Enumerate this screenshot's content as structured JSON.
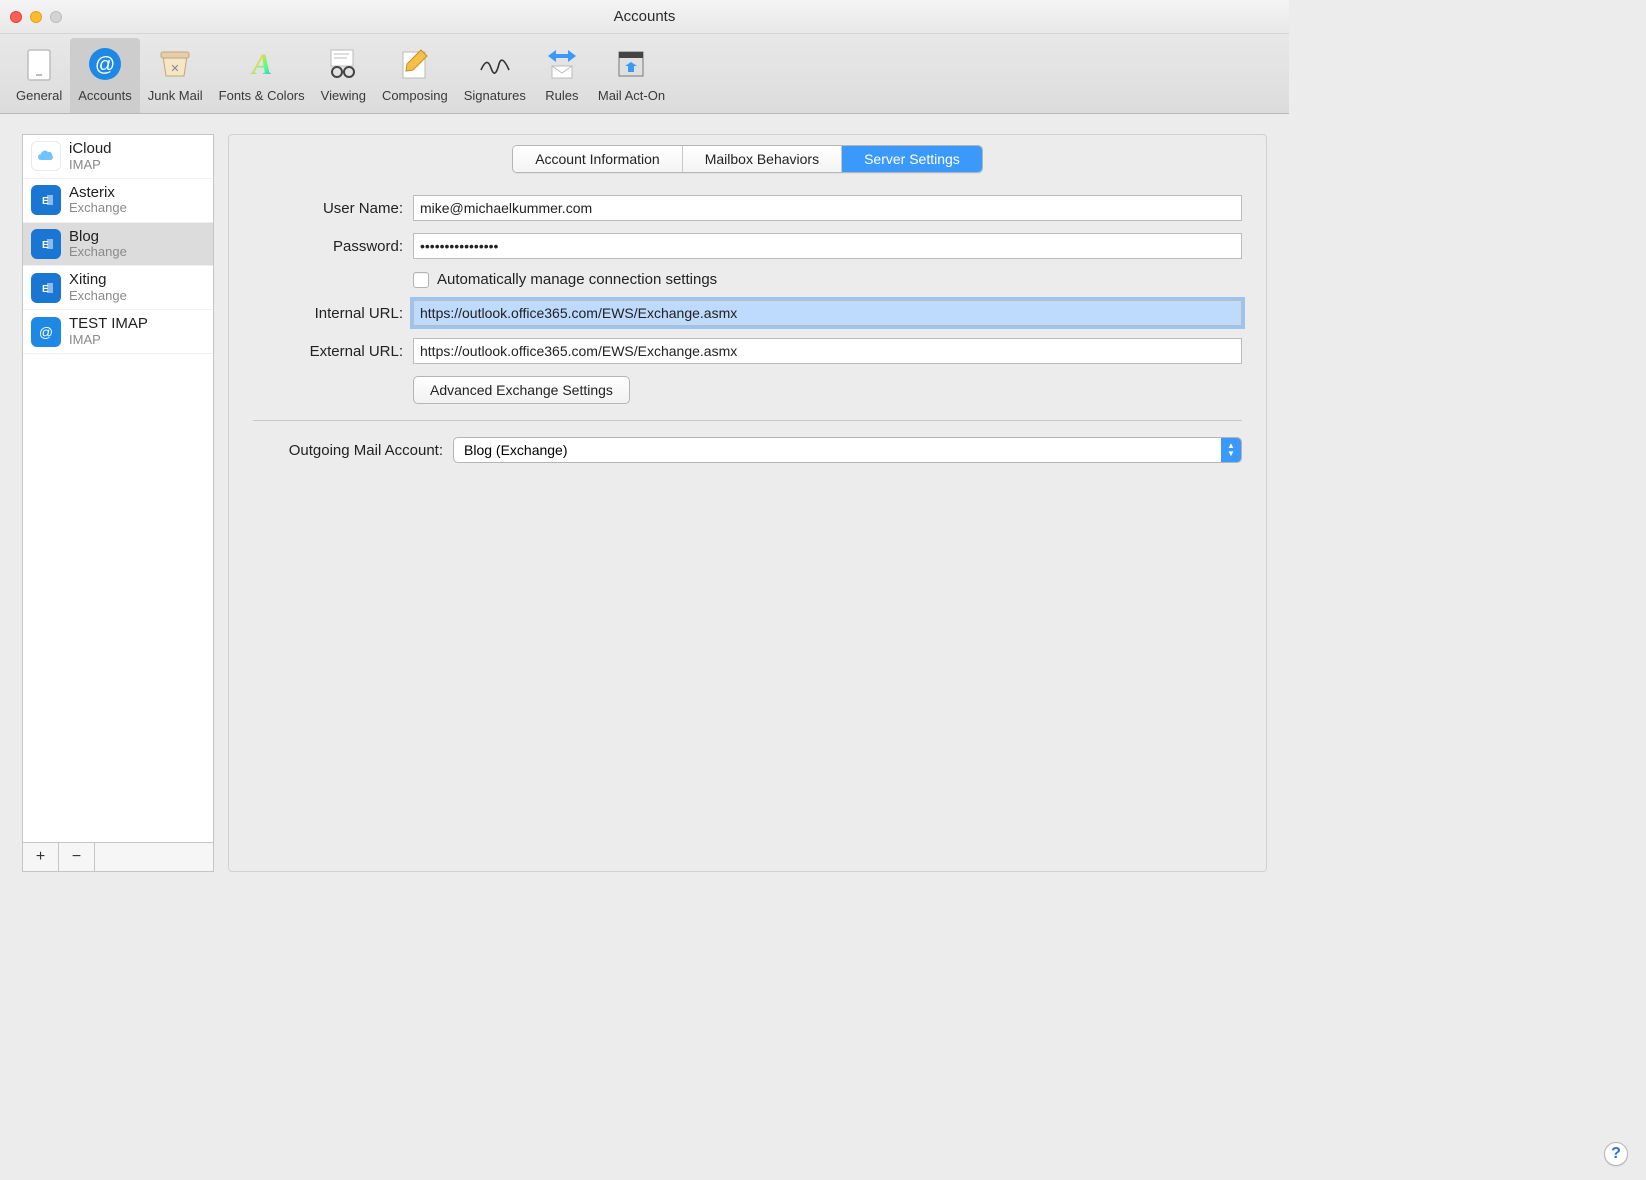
{
  "window": {
    "title": "Accounts"
  },
  "toolbar": {
    "items": [
      {
        "label": "General"
      },
      {
        "label": "Accounts"
      },
      {
        "label": "Junk Mail"
      },
      {
        "label": "Fonts & Colors"
      },
      {
        "label": "Viewing"
      },
      {
        "label": "Composing"
      },
      {
        "label": "Signatures"
      },
      {
        "label": "Rules"
      },
      {
        "label": "Mail Act-On"
      }
    ],
    "selected_index": 1
  },
  "accounts": [
    {
      "name": "iCloud",
      "protocol": "IMAP",
      "type": "icloud"
    },
    {
      "name": "Asterix",
      "protocol": "Exchange",
      "type": "exchange"
    },
    {
      "name": "Blog",
      "protocol": "Exchange",
      "type": "exchange"
    },
    {
      "name": "Xiting",
      "protocol": "Exchange",
      "type": "exchange"
    },
    {
      "name": "TEST IMAP",
      "protocol": "IMAP",
      "type": "at"
    }
  ],
  "selected_account_index": 2,
  "sidebar_footer": {
    "add": "+",
    "remove": "−"
  },
  "tabs": {
    "items": [
      "Account Information",
      "Mailbox Behaviors",
      "Server Settings"
    ],
    "active_index": 2
  },
  "form": {
    "username_label": "User Name:",
    "username_value": "mike@michaelkummer.com",
    "password_label": "Password:",
    "password_value": "••••••••••••••••",
    "auto_label": "Automatically manage connection settings",
    "auto_checked": false,
    "internal_label": "Internal URL:",
    "internal_value": "https://outlook.office365.com/EWS/Exchange.asmx",
    "external_label": "External URL:",
    "external_value": "https://outlook.office365.com/EWS/Exchange.asmx",
    "advanced_button": "Advanced Exchange Settings",
    "outgoing_label": "Outgoing Mail Account:",
    "outgoing_value": "Blog (Exchange)"
  },
  "help": "?"
}
